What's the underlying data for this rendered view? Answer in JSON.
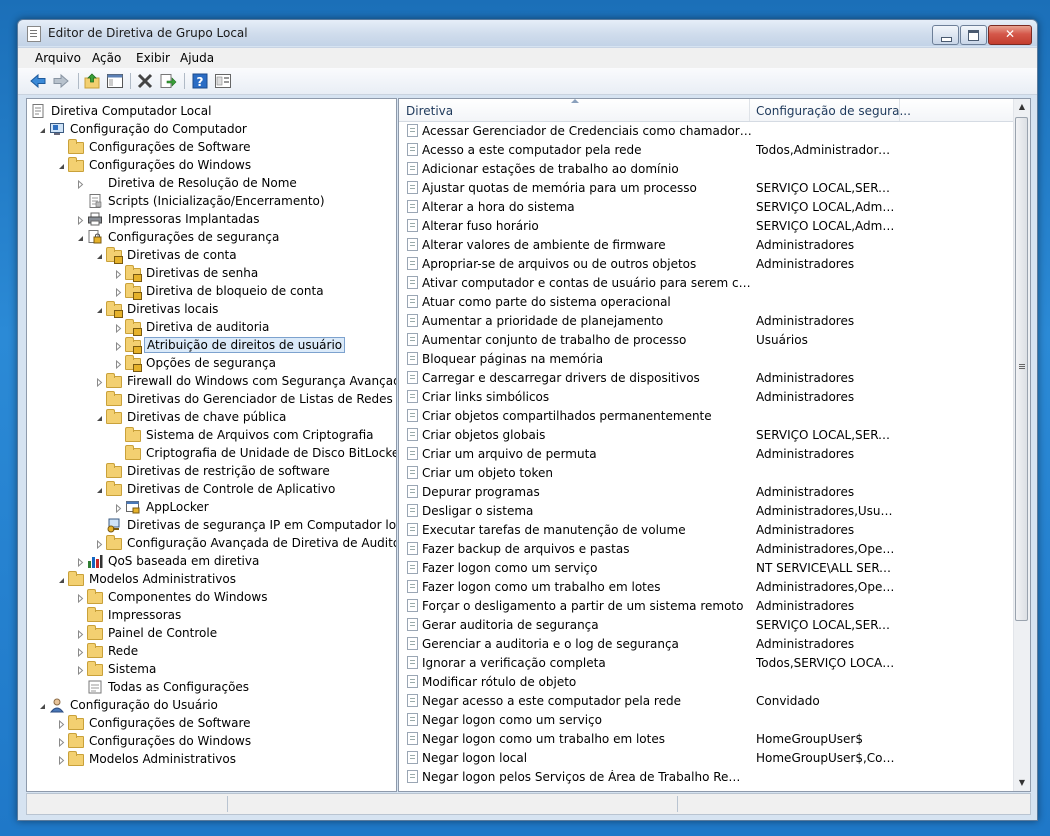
{
  "window": {
    "title": "Editor de Diretiva de Grupo Local"
  },
  "menu": [
    "Arquivo",
    "Ação",
    "Exibir",
    "Ajuda"
  ],
  "toolbar": [
    "back-icon",
    "forward-icon",
    "up-folder-icon",
    "show-hide-tree-icon",
    "delete-icon",
    "export-list-icon",
    "help-icon",
    "properties-icon"
  ],
  "tree": [
    {
      "label": "Diretiva Computador Local",
      "level": 0,
      "icon": "policy-doc",
      "exp": ""
    },
    {
      "label": "Configuração do Computador",
      "level": 1,
      "icon": "computer",
      "exp": "open"
    },
    {
      "label": "Configurações de Software",
      "level": 2,
      "icon": "folder",
      "exp": ""
    },
    {
      "label": "Configurações do Windows",
      "level": 2,
      "icon": "folder",
      "exp": "open"
    },
    {
      "label": "Diretiva de Resolução de Nome",
      "level": 3,
      "icon": "none",
      "exp": "closed"
    },
    {
      "label": "Scripts (Inicialização/Encerramento)",
      "level": 3,
      "icon": "script",
      "exp": ""
    },
    {
      "label": "Impressoras Implantadas",
      "level": 3,
      "icon": "printer",
      "exp": "closed"
    },
    {
      "label": "Configurações de segurança",
      "level": 3,
      "icon": "security",
      "exp": "open"
    },
    {
      "label": "Diretivas de conta",
      "level": 4,
      "icon": "folder-lock",
      "exp": "open"
    },
    {
      "label": "Diretivas de senha",
      "level": 5,
      "icon": "folder-lock",
      "exp": "closed"
    },
    {
      "label": "Diretiva de bloqueio de conta",
      "level": 5,
      "icon": "folder-lock",
      "exp": "closed"
    },
    {
      "label": "Diretivas locais",
      "level": 4,
      "icon": "folder-lock",
      "exp": "open"
    },
    {
      "label": "Diretiva de auditoria",
      "level": 5,
      "icon": "folder-lock",
      "exp": "closed"
    },
    {
      "label": "Atribuição de direitos de usuário",
      "level": 5,
      "icon": "folder-lock",
      "exp": "closed",
      "selected": true
    },
    {
      "label": "Opções de segurança",
      "level": 5,
      "icon": "folder-lock",
      "exp": "closed"
    },
    {
      "label": "Firewall do Windows com Segurança Avançada",
      "level": 4,
      "icon": "folder",
      "exp": "closed"
    },
    {
      "label": "Diretivas do Gerenciador de Listas de Redes",
      "level": 4,
      "icon": "folder",
      "exp": ""
    },
    {
      "label": "Diretivas de chave pública",
      "level": 4,
      "icon": "folder",
      "exp": "open"
    },
    {
      "label": "Sistema de Arquivos com Criptografia",
      "level": 5,
      "icon": "folder",
      "exp": ""
    },
    {
      "label": "Criptografia de Unidade de Disco BitLocker",
      "level": 5,
      "icon": "folder",
      "exp": ""
    },
    {
      "label": "Diretivas de restrição de software",
      "level": 4,
      "icon": "folder",
      "exp": ""
    },
    {
      "label": "Diretivas de Controle de Aplicativo",
      "level": 4,
      "icon": "folder",
      "exp": "open"
    },
    {
      "label": "AppLocker",
      "level": 5,
      "icon": "applocker",
      "exp": "closed"
    },
    {
      "label": "Diretivas de segurança IP em Computador local",
      "level": 4,
      "icon": "ipsec",
      "exp": ""
    },
    {
      "label": "Configuração Avançada de Diretiva de Auditoria",
      "level": 4,
      "icon": "folder",
      "exp": "closed"
    },
    {
      "label": "QoS baseada em diretiva",
      "level": 3,
      "icon": "chart",
      "exp": "closed"
    },
    {
      "label": "Modelos Administrativos",
      "level": 2,
      "icon": "folder",
      "exp": "open"
    },
    {
      "label": "Componentes do Windows",
      "level": 3,
      "icon": "folder",
      "exp": "closed"
    },
    {
      "label": "Impressoras",
      "level": 3,
      "icon": "folder",
      "exp": ""
    },
    {
      "label": "Painel de Controle",
      "level": 3,
      "icon": "folder",
      "exp": "closed"
    },
    {
      "label": "Rede",
      "level": 3,
      "icon": "folder",
      "exp": "closed"
    },
    {
      "label": "Sistema",
      "level": 3,
      "icon": "folder",
      "exp": "closed"
    },
    {
      "label": "Todas as Configurações",
      "level": 3,
      "icon": "settings",
      "exp": ""
    },
    {
      "label": "Configuração do Usuário",
      "level": 1,
      "icon": "user",
      "exp": "open"
    },
    {
      "label": "Configurações de Software",
      "level": 2,
      "icon": "folder",
      "exp": "closed"
    },
    {
      "label": "Configurações do Windows",
      "level": 2,
      "icon": "folder",
      "exp": "closed"
    },
    {
      "label": "Modelos Administrativos",
      "level": 2,
      "icon": "folder",
      "exp": "closed"
    }
  ],
  "list": {
    "columns": [
      "Diretiva",
      "Configuração de segura..."
    ],
    "rows": [
      [
        "Acessar Gerenciador de Credenciais como chamador confiá...",
        ""
      ],
      [
        "Acesso a este computador pela rede",
        "Todos,Administradores,..."
      ],
      [
        "Adicionar estações de trabalho ao domínio",
        ""
      ],
      [
        "Ajustar quotas de memória para um processo",
        "SERVIÇO LOCAL,SERVIÇ..."
      ],
      [
        "Alterar a hora do sistema",
        "SERVIÇO LOCAL,Admini..."
      ],
      [
        "Alterar fuso horário",
        "SERVIÇO LOCAL,Admini..."
      ],
      [
        "Alterar valores de ambiente de firmware",
        "Administradores"
      ],
      [
        "Apropriar-se de arquivos ou de outros objetos",
        "Administradores"
      ],
      [
        "Ativar computador e contas de usuário para serem confiávei...",
        ""
      ],
      [
        "Atuar como parte do sistema operacional",
        ""
      ],
      [
        "Aumentar a prioridade de planejamento",
        "Administradores"
      ],
      [
        "Aumentar conjunto de trabalho de processo",
        "Usuários"
      ],
      [
        "Bloquear páginas na memória",
        ""
      ],
      [
        "Carregar e descarregar drivers de dispositivos",
        "Administradores"
      ],
      [
        "Criar links simbólicos",
        "Administradores"
      ],
      [
        "Criar objetos compartilhados permanentemente",
        ""
      ],
      [
        "Criar objetos globais",
        "SERVIÇO LOCAL,SERVIÇ..."
      ],
      [
        "Criar um arquivo de permuta",
        "Administradores"
      ],
      [
        "Criar um objeto token",
        ""
      ],
      [
        "Depurar programas",
        "Administradores"
      ],
      [
        "Desligar o sistema",
        "Administradores,Usuári..."
      ],
      [
        "Executar tarefas de manutenção de volume",
        "Administradores"
      ],
      [
        "Fazer backup de arquivos e pastas",
        "Administradores,Operad..."
      ],
      [
        "Fazer logon como um serviço",
        "NT SERVICE\\ALL SERVIC..."
      ],
      [
        "Fazer logon como um trabalho em lotes",
        "Administradores,Operad..."
      ],
      [
        "Forçar o desligamento a partir de um sistema remoto",
        "Administradores"
      ],
      [
        "Gerar auditoria de segurança",
        "SERVIÇO LOCAL,SERVIÇ..."
      ],
      [
        "Gerenciar a auditoria e o log de segurança",
        "Administradores"
      ],
      [
        "Ignorar a verificação completa",
        "Todos,SERVIÇO LOCAL,..."
      ],
      [
        "Modificar rótulo de objeto",
        ""
      ],
      [
        "Negar acesso a este computador pela rede",
        "Convidado"
      ],
      [
        "Negar logon como um serviço",
        ""
      ],
      [
        "Negar logon como um trabalho em lotes",
        "HomeGroupUser$"
      ],
      [
        "Negar logon local",
        "HomeGroupUser$,Convi..."
      ],
      [
        "Negar logon pelos Serviços de Área de Trabalho Remota",
        ""
      ]
    ]
  },
  "colors": {
    "folder": "#f3d071",
    "selection": "#dbeaf9",
    "header_text": "#1e395b"
  }
}
